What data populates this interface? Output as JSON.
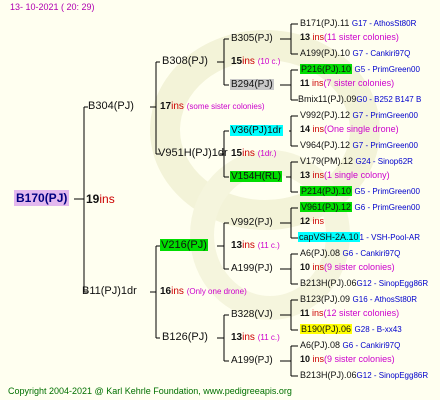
{
  "header": {
    "date": "13- 10-2021 ( 20: 29)"
  },
  "footer": {
    "copyright": "Copyright 2004-2021 @ Karl Kehrle Foundation",
    "site": "www.pedigreeapis.org"
  },
  "ins_word": "ins",
  "root": {
    "name": "B170(PJ)",
    "ins": "19"
  },
  "gen1": [
    {
      "name": "B304(PJ)",
      "ins": "17",
      "note": "(some sister colonies)"
    },
    {
      "name": "B11(PJ)1dr",
      "ins": "16",
      "note": "(Only one drone)"
    }
  ],
  "gen2": [
    {
      "name": "B308(PJ)",
      "ins": "15",
      "note": "(10 c.)"
    },
    {
      "name": "V951H(PJ)1dr",
      "ins": "15",
      "note": "(1dr.)"
    },
    {
      "name": "V216(PJ)",
      "ins": "13",
      "note": "(11 c.)"
    },
    {
      "name": "B126(PJ)",
      "ins": "13",
      "note": "(11 c.)"
    }
  ],
  "gen3": [
    {
      "name": "B305(PJ)"
    },
    {
      "name": "B294(PJ)"
    },
    {
      "name": "V36(PJ)1dr"
    },
    {
      "name": "V154H(RL)"
    },
    {
      "name": "V992(PJ)"
    },
    {
      "name": "A199(PJ)"
    },
    {
      "name": "B328(VJ)"
    },
    {
      "name": "A199(PJ)"
    }
  ],
  "gen4": [
    {
      "name": "B171(PJ).11",
      "info": "G17 - AthosSt80R"
    },
    {
      "ins": "13",
      "note": "(11 sister colonies)"
    },
    {
      "name": "A199(PJ).10",
      "info": "G7 - Cankiri97Q"
    },
    {
      "name": "P216(PJ).10",
      "info": "G5 - PrimGreen00"
    },
    {
      "ins": "11",
      "note": "(7 sister colonies)"
    },
    {
      "name": "Bmix11(PJ).09",
      "info": "G0 - B252 B147 B"
    },
    {
      "name": "V992(PJ).12",
      "info": "G7 - PrimGreen00"
    },
    {
      "ins": "14",
      "note": "(One single drone)"
    },
    {
      "name": "V964(PJ).12",
      "info": "G7 - PrimGreen00"
    },
    {
      "name": "V179(PM).12",
      "info": "G24 - Sinop62R"
    },
    {
      "ins": "13",
      "note": "(1 single colony)"
    },
    {
      "name": "P214(PJ).10",
      "info": "G5 - PrimGreen00"
    },
    {
      "name": "V961(PJ).12",
      "info": "G6 - PrimGreen00"
    },
    {
      "ins": "12",
      "note": ""
    },
    {
      "name": "capVSH-2A.10",
      "info": "1 - VSH-Pool-AR"
    },
    {
      "name": "A6(PJ).08",
      "info": "G6 - Cankiri97Q"
    },
    {
      "ins": "10",
      "note": "(9 sister colonies)"
    },
    {
      "name": "B213H(PJ).06",
      "info": "G12 - SinopEgg86R"
    },
    {
      "name": "B123(PJ).09",
      "info": "G16 - AthosSt80R"
    },
    {
      "ins": "11",
      "note": "(12 sister colonies)"
    },
    {
      "name": "B190(PJ).06",
      "info": "G28 - B-xx43"
    },
    {
      "name": "A6(PJ).08",
      "info": "G6 - Cankiri97Q"
    },
    {
      "ins": "10",
      "note": "(9 sister colonies)"
    },
    {
      "name": "B213H(PJ).06",
      "info": "G12 - SinopEgg86R"
    }
  ]
}
